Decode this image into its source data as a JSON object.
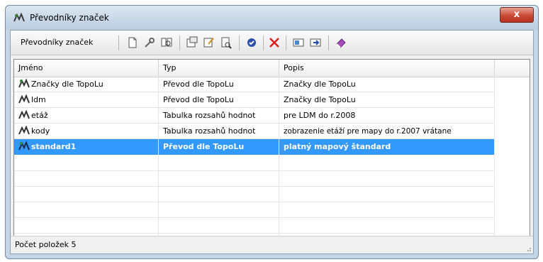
{
  "window": {
    "title": "Převodníky značek",
    "close_label": "x"
  },
  "toolbar": {
    "label": "Převodníky značek",
    "buttons": [
      {
        "name": "new-document-icon"
      },
      {
        "name": "edit-wrench-icon"
      },
      {
        "name": "find-replace-icon"
      },
      {
        "name": "properties-icon"
      },
      {
        "name": "edit-note-icon"
      },
      {
        "name": "print-preview-icon"
      },
      {
        "name": "apply-circle-icon"
      },
      {
        "name": "delete-x-icon"
      },
      {
        "name": "import-icon"
      },
      {
        "name": "export-icon"
      },
      {
        "name": "eraser-icon"
      }
    ]
  },
  "table": {
    "columns": [
      "Jméno",
      "Typ",
      "Popis"
    ],
    "rows": [
      {
        "name": "Značky dle TopoLu",
        "type": "Převod dle TopoLu",
        "desc": "Značky dle TopoLu"
      },
      {
        "name": "ldm",
        "type": "Převod dle TopoLu",
        "desc": "Značky dle TopoLu"
      },
      {
        "name": "etáž",
        "type": "Tabulka rozsahů hodnot",
        "desc": "pre LDM do r.2008"
      },
      {
        "name": "kody",
        "type": "Tabulka rozsahů hodnot",
        "desc": "zobrazenie etáží pre mapy do r.2007 vrátane"
      },
      {
        "name": "standard1",
        "type": "Převod dle TopoLu",
        "desc": "platný mapový štandard"
      }
    ],
    "selected_index": 4
  },
  "status": {
    "text": "Počet položek 5"
  },
  "colors": {
    "selection": "#3399ff",
    "close_button": "#c84a33"
  }
}
